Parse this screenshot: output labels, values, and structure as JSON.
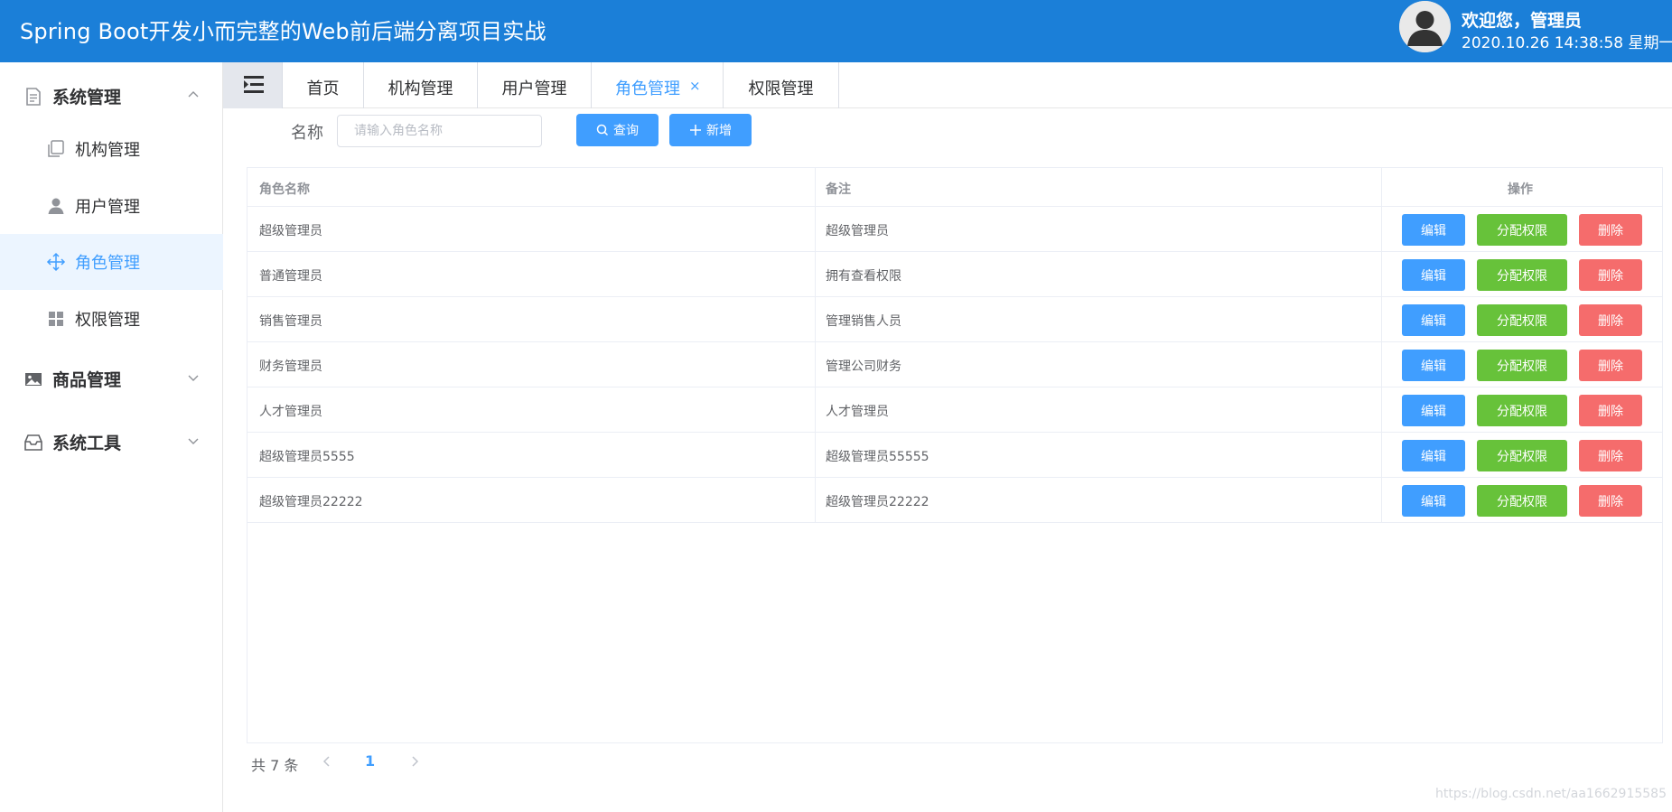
{
  "header": {
    "title": "Spring Boot开发小而完整的Web前后端分离项目实战",
    "welcome": "欢迎您，管理员",
    "datetime": "2020.10.26 14:38:58 星期一",
    "background_color": "#1b7fd8"
  },
  "sidebar": {
    "groups": [
      {
        "label": "系统管理",
        "icon": "document-icon",
        "expanded": true
      },
      {
        "label": "商品管理",
        "icon": "picture-icon",
        "expanded": false
      },
      {
        "label": "系统工具",
        "icon": "box-icon",
        "expanded": false
      }
    ],
    "items": [
      {
        "label": "机构管理",
        "icon": "copy-icon"
      },
      {
        "label": "用户管理",
        "icon": "user-icon"
      },
      {
        "label": "角色管理",
        "icon": "move-icon",
        "active": true
      },
      {
        "label": "权限管理",
        "icon": "grid-icon"
      }
    ],
    "active_color": "#409eff"
  },
  "tabs": [
    {
      "label": "首页"
    },
    {
      "label": "机构管理"
    },
    {
      "label": "用户管理"
    },
    {
      "label": "角色管理",
      "active": true,
      "closable": true,
      "close_glyph": "×"
    },
    {
      "label": "权限管理"
    }
  ],
  "search": {
    "label": "名称",
    "placeholder": "请输入角色名称",
    "query_button": "查询",
    "add_button": "新增"
  },
  "table": {
    "columns": [
      "角色名称",
      "备注",
      "操作"
    ],
    "rows": [
      {
        "name": "超级管理员",
        "remark": "超级管理员"
      },
      {
        "name": "普通管理员",
        "remark": "拥有查看权限"
      },
      {
        "name": "销售管理员",
        "remark": "管理销售人员"
      },
      {
        "name": "财务管理员",
        "remark": "管理公司财务"
      },
      {
        "name": "人才管理员",
        "remark": "人才管理员"
      },
      {
        "name": "超级管理员5555",
        "remark": "超级管理员55555"
      },
      {
        "name": "超级管理员22222",
        "remark": "超级管理员22222"
      }
    ],
    "actions": {
      "edit": "编辑",
      "assign": "分配权限",
      "delete": "删除"
    },
    "colors": {
      "edit": "#409eff",
      "assign": "#67c23a",
      "delete": "#f56c6c"
    }
  },
  "pagination": {
    "total_text": "共 7 条",
    "current_page": "1"
  },
  "watermark": "https://blog.csdn.net/aa1662915585"
}
